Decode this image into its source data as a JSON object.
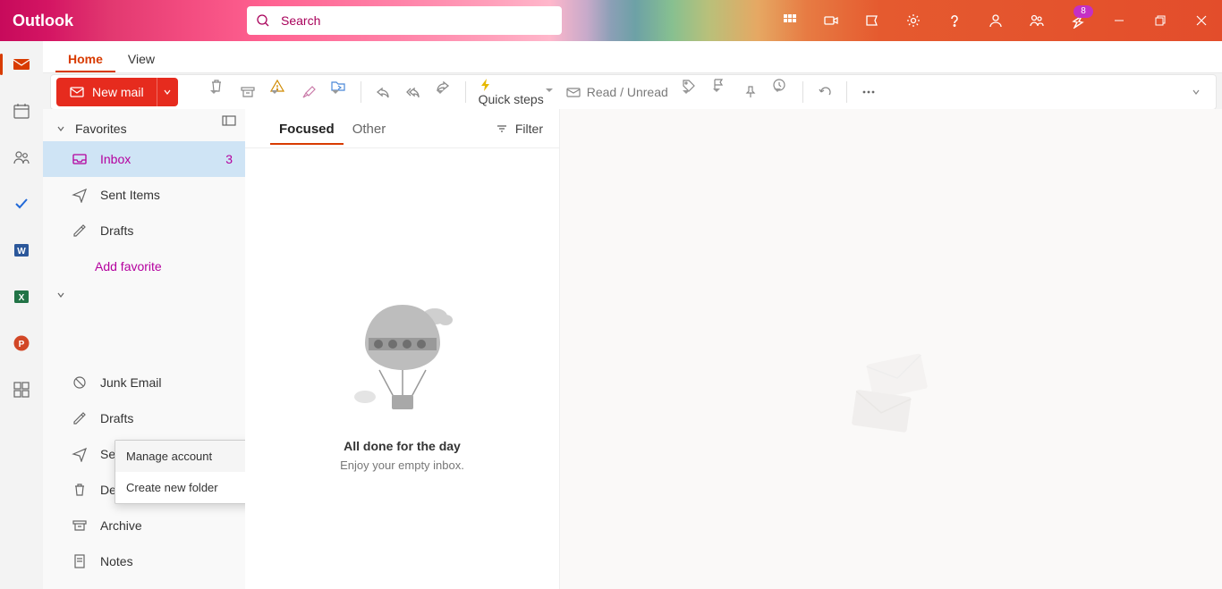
{
  "brand": "Outlook",
  "search": {
    "placeholder": "Search"
  },
  "notification_badge": "8",
  "tabs": {
    "home": "Home",
    "view": "View"
  },
  "ribbon": {
    "new_mail": "New mail",
    "quick_steps": "Quick steps",
    "read_unread": "Read / Unread"
  },
  "sidebar": {
    "favorites_header": "Favorites",
    "favorites": [
      {
        "label": "Inbox",
        "count": "3"
      },
      {
        "label": "Sent Items"
      },
      {
        "label": "Drafts"
      }
    ],
    "add_favorite": "Add favorite",
    "context_menu": {
      "manage_account": "Manage account",
      "create_folder": "Create new folder"
    },
    "account_folders": [
      {
        "label": "Junk Email"
      },
      {
        "label": "Drafts"
      },
      {
        "label": "Sent Items"
      },
      {
        "label": "Deleted Items"
      },
      {
        "label": "Archive"
      },
      {
        "label": "Notes"
      }
    ]
  },
  "list": {
    "tab_focused": "Focused",
    "tab_other": "Other",
    "filter": "Filter",
    "empty_title": "All done for the day",
    "empty_sub": "Enjoy your empty inbox."
  }
}
